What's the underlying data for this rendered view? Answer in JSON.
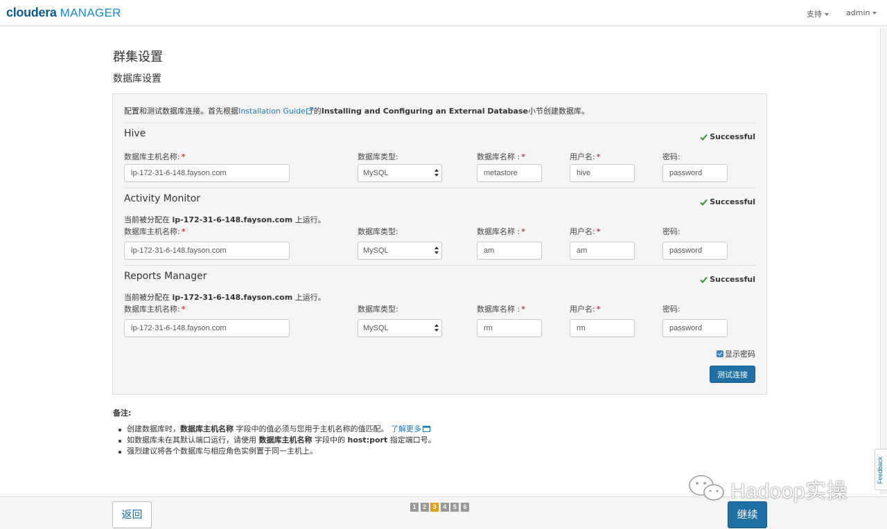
{
  "header": {
    "logo_brand": "cloudera",
    "logo_product": "MANAGER",
    "menu_support": "支持",
    "menu_user": "admin"
  },
  "page": {
    "title": "群集设置",
    "subtitle": "数据库设置"
  },
  "intro": {
    "prefix": "配置和测试数据库连接。首先根据",
    "link": "Installation Guide",
    "mid": "的",
    "bold": "Installing and Configuring an External Database",
    "suffix": "小节创建数据库。"
  },
  "labels": {
    "host": "数据库主机名称:",
    "type": "数据库类型:",
    "dbname": "数据库名称 :",
    "user": "用户名:",
    "password": "密码:",
    "required": "*"
  },
  "sections": [
    {
      "title": "Hive",
      "status": "Successful",
      "host": "ip-172-31-6-148.fayson.com",
      "type": "MySQL",
      "dbname": "metastore",
      "user": "hive",
      "password": "password"
    },
    {
      "title": "Activity Monitor",
      "status": "Successful",
      "assigned_prefix": "当前被分配在",
      "assigned_host": "ip-172-31-6-148.fayson.com",
      "assigned_suffix": "上运行。",
      "host": "ip-172-31-6-148.fayson.com",
      "type": "MySQL",
      "dbname": "am",
      "user": "am",
      "password": "password"
    },
    {
      "title": "Reports Manager",
      "status": "Successful",
      "assigned_prefix": "当前被分配在",
      "assigned_host": "ip-172-31-6-148.fayson.com",
      "assigned_suffix": "上运行。",
      "host": "ip-172-31-6-148.fayson.com",
      "type": "MySQL",
      "dbname": "rm",
      "user": "rm",
      "password": "password"
    }
  ],
  "show_password": {
    "label": "显示密码",
    "checked": true
  },
  "test_button": "测试连接",
  "notes": {
    "title": "备注:",
    "item1_a": "创建数据库时，",
    "item1_b": "数据库主机名称",
    "item1_c": "字段中的值必须与您用于主机名称的值匹配。",
    "item1_link": "了解更多",
    "item2_a": "如数据库未在其默认端口运行，请使用",
    "item2_b": "数据库主机名称",
    "item2_c": "字段中的",
    "item2_d": "host:port",
    "item2_e": "指定端口号。",
    "item3": "强烈建议将各个数据库与相应角色实例置于同一主机上。"
  },
  "footer": {
    "back": "返回",
    "next": "继续",
    "steps": [
      "1",
      "2",
      "3",
      "4",
      "5",
      "6"
    ],
    "active_step": "3"
  },
  "feedback": "Feedback",
  "watermark": "Hadoop实操",
  "colors": {
    "primary": "#1d6fa5",
    "link": "#1a7abf",
    "success": "#3a9a3a",
    "required": "#b94a48",
    "step_active": "#e8a00c"
  }
}
